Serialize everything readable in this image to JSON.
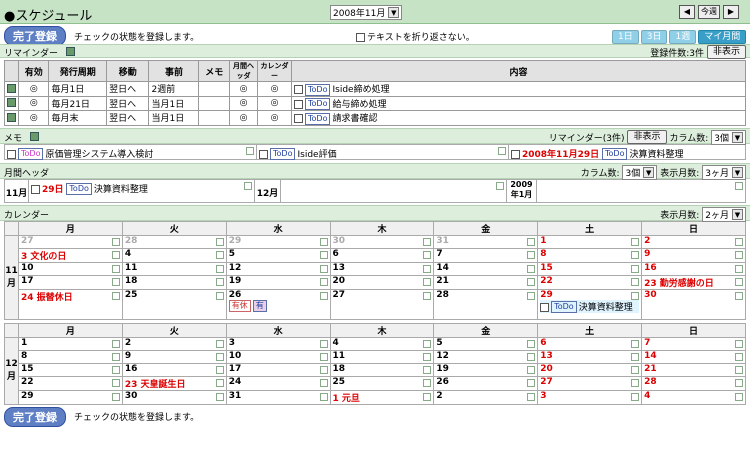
{
  "header": {
    "title": "●スケジュール",
    "month": "2008年11月",
    "today": "今週"
  },
  "topbar": {
    "register": "完了登録",
    "note": "チェックの状態を登録します。",
    "wrap": "テキストを折り返さない。",
    "tabs": [
      "1日",
      "3日",
      "1週",
      "マイ月間"
    ]
  },
  "reminder": {
    "title": "リマインダー",
    "count": "登録件数:3件",
    "hide": "非表示",
    "cols": [
      "有効",
      "発行周期",
      "移動",
      "事前",
      "メモ",
      "月間ヘッダ",
      "カレンダー",
      "内容"
    ],
    "rows": [
      [
        "◎",
        "毎月1日",
        "翌日へ",
        "2週前",
        "",
        "◎",
        "◎",
        "Iside締め処理"
      ],
      [
        "◎",
        "毎月21日",
        "翌日へ",
        "当月1日",
        "",
        "◎",
        "◎",
        "給与締め処理"
      ],
      [
        "◎",
        "毎月末",
        "翌日へ",
        "当月1日",
        "",
        "◎",
        "◎",
        "請求書確認"
      ]
    ]
  },
  "memo": {
    "title": "メモ",
    "reminder": "リマインダー(3件)",
    "hide": "非表示",
    "colcount": "カラム数:",
    "colval": "3個",
    "items": [
      {
        "text": "原価管理システム導入検討"
      },
      {
        "text": "Iside評価"
      },
      {
        "date": "2008年11月29日",
        "text": "決算資料整理"
      }
    ]
  },
  "mh": {
    "title": "月間ヘッダ",
    "colcount": "カラム数:",
    "colval": "3個",
    "months": "表示月数:",
    "monval": "3ヶ月",
    "m1": "11月",
    "m1d": "29日",
    "m1t": "決算資料整理",
    "m2": "12月",
    "m3": "2009年1月"
  },
  "cal": {
    "title": "カレンダー",
    "months": "表示月数:",
    "monval": "2ヶ月",
    "days": [
      "月",
      "火",
      "水",
      "木",
      "金",
      "土",
      "日"
    ],
    "nov": {
      "label": "11月",
      "weeks": [
        [
          "27",
          "28",
          "29",
          "30",
          "31",
          "1",
          "2"
        ],
        [
          "3 文化の日",
          "4",
          "5",
          "6",
          "7",
          "8",
          "9"
        ],
        [
          "10",
          "11",
          "12",
          "13",
          "14",
          "15",
          "16"
        ],
        [
          "17",
          "18",
          "19",
          "20",
          "21",
          "22",
          "23 勤労感謝の日"
        ],
        [
          "24 振替休日",
          "25",
          "26",
          "27",
          "28",
          "29",
          "30"
        ]
      ]
    },
    "ev26": "有休",
    "ev26b": "有",
    "ev29": "決算資料整理",
    "dec": {
      "label": "12月",
      "weeks": [
        [
          "1",
          "2",
          "3",
          "4",
          "5",
          "6",
          "7"
        ],
        [
          "8",
          "9",
          "10",
          "11",
          "12",
          "13",
          "14"
        ],
        [
          "15",
          "16",
          "17",
          "18",
          "19",
          "20",
          "21"
        ],
        [
          "22",
          "23 天皇誕生日",
          "24",
          "25",
          "26",
          "27",
          "28"
        ],
        [
          "29",
          "30",
          "31",
          "1 元旦",
          "2",
          "3",
          "4"
        ]
      ]
    }
  },
  "bottom": {
    "register": "完了登録",
    "note": "チェックの状態を登録します。"
  }
}
